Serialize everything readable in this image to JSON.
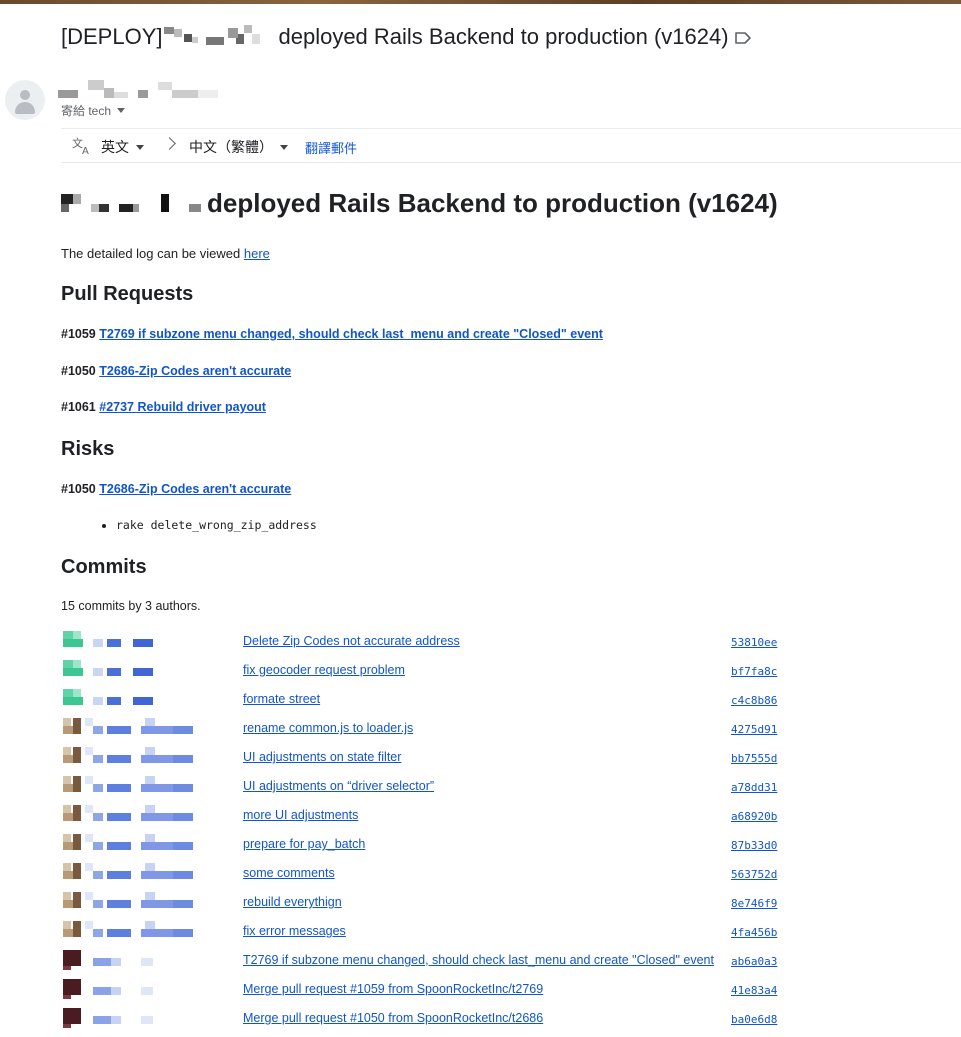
{
  "email": {
    "subject_prefix": "[DEPLOY]",
    "subject_rest": "deployed Rails Backend to production (v1624)",
    "to_label": "寄給 tech"
  },
  "translate_bar": {
    "source_lang": "英文",
    "target_lang": "中文（繁體）",
    "translate_link": "翻譯郵件"
  },
  "body": {
    "title_rest": "deployed Rails Backend to production (v1624)",
    "intro_text": "The detailed log can be viewed ",
    "intro_link": "here",
    "pull_requests_heading": "Pull Requests",
    "pull_requests": [
      {
        "num": "#1059",
        "title": "T2769 if subzone menu changed, should check last_menu and create \"Closed\" event"
      },
      {
        "num": "#1050",
        "title": "T2686-Zip Codes aren't accurate"
      },
      {
        "num": "#1061",
        "title": "#2737 Rebuild driver payout"
      }
    ],
    "risks_heading": "Risks",
    "risk_pr": {
      "num": "#1050",
      "title": "T2686-Zip Codes aren't accurate"
    },
    "risk_items": [
      "rake delete_wrong_zip_address"
    ],
    "commits_heading": "Commits",
    "commits_summary": "15 commits by 3 authors.",
    "commits": [
      {
        "msg": "Delete Zip Codes not accurate address",
        "sha": "53810ee",
        "author": "a"
      },
      {
        "msg": "fix geocoder request problem",
        "sha": "bf7fa8c",
        "author": "a"
      },
      {
        "msg": "formate street",
        "sha": "c4c8b86",
        "author": "a"
      },
      {
        "msg": "rename common.js to loader.js",
        "sha": "4275d91",
        "author": "b"
      },
      {
        "msg": "UI adjustments on state filter",
        "sha": "bb7555d",
        "author": "b"
      },
      {
        "msg": "UI adjustments on “driver selector”",
        "sha": "a78dd31",
        "author": "b"
      },
      {
        "msg": "more UI adjustments",
        "sha": "a68920b",
        "author": "b"
      },
      {
        "msg": "prepare for pay_batch",
        "sha": "87b33d0",
        "author": "b"
      },
      {
        "msg": "some comments",
        "sha": "563752d",
        "author": "b"
      },
      {
        "msg": "rebuild everythign",
        "sha": "8e746f9",
        "author": "b"
      },
      {
        "msg": "fix error messages",
        "sha": "4fa456b",
        "author": "b"
      },
      {
        "msg": "T2769 if subzone menu changed, should check last_menu and create \"Closed\" event",
        "sha": "ab6a0a3",
        "author": "c"
      },
      {
        "msg": "Merge pull request #1059 from SpoonRocketInc/t2769",
        "sha": "41e83a4",
        "author": "c"
      },
      {
        "msg": "Merge pull request #1050 from SpoonRocketInc/t2686",
        "sha": "ba0e6d8",
        "author": "c"
      }
    ]
  },
  "colors": {
    "link": "#1155cc",
    "translate_link": "#1558d6",
    "text": "#202124",
    "muted": "#5f6368"
  }
}
